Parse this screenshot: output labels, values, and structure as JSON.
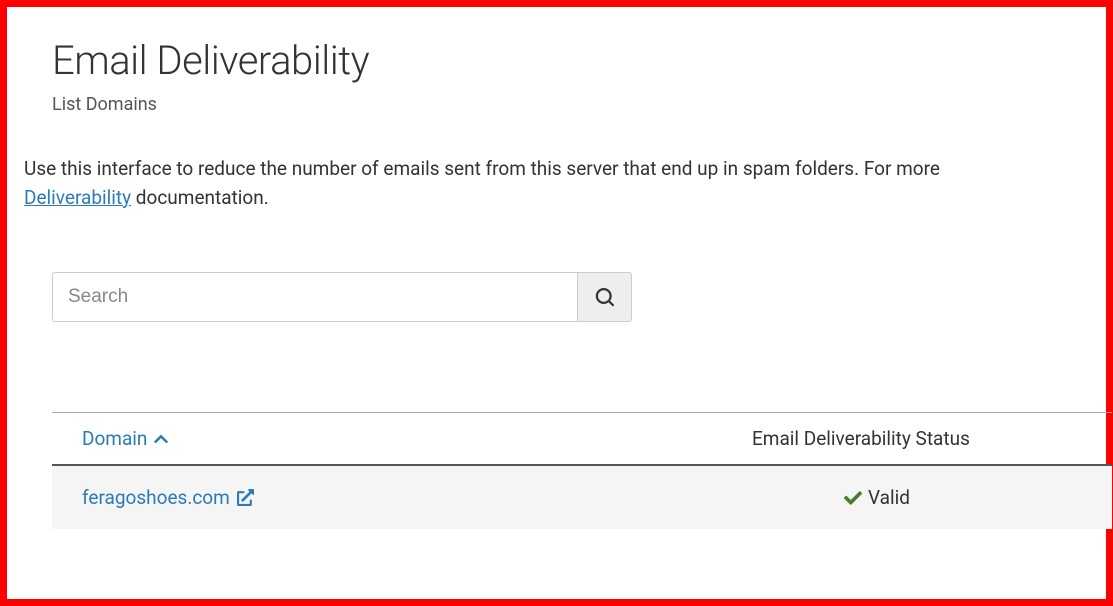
{
  "header": {
    "title": "Email Deliverability",
    "subtitle": "List Domains"
  },
  "description": {
    "intro_text": "Use this interface to reduce the number of emails sent from this server that end up in spam folders. For more",
    "link_text": "Deliverability",
    "after_link": " documentation."
  },
  "search": {
    "placeholder": "Search"
  },
  "table": {
    "col_domain": "Domain",
    "col_status": "Email Deliverability Status",
    "rows": [
      {
        "domain": "feragoshoes.com",
        "status": "Valid"
      }
    ]
  }
}
